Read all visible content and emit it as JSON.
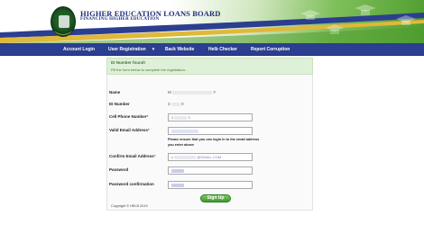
{
  "header": {
    "title": "HIGHER EDUCATION LOANS BOARD",
    "subtitle": "FINANCING HIGHER EDUCATION"
  },
  "nav": {
    "items": [
      {
        "label": "Account Login"
      },
      {
        "label": "User Registration"
      },
      {
        "label": "Back Website"
      },
      {
        "label": "Helb Checker"
      },
      {
        "label": "Report Corruption"
      }
    ]
  },
  "alert": {
    "title": "ID Number found!",
    "text": "Fill the form below to complete the registration..."
  },
  "form": {
    "name_label": "Name",
    "name_value_start": "M",
    "name_value_end": "Y",
    "id_label": "ID Number",
    "id_value_start": "3",
    "id_value_end": "0",
    "phone_label": "Cell Phone Number",
    "phone_value_start": "0",
    "phone_value_end": "5",
    "email_label": "Valid Email Address",
    "email_hint": "Please ensure that you can login in to the email address you enter above",
    "confirm_email_label": "Confirm Email Address",
    "confirm_email_value_start": "s",
    "confirm_email_value_end": "@GMAIL.COM",
    "password_label": "Password",
    "password_confirm_label": "Password confirmation",
    "required_mark": "*",
    "submit_label": "Sign Up"
  },
  "footer": {
    "copyright": "Copyright © HELB 2019"
  },
  "colors": {
    "nav_bg": "#2b3e8f",
    "brand_blue": "#1f2e7a",
    "brand_green": "#4f9d2f",
    "alert_bg": "#dff0d8",
    "button_green": "#3f9a2b"
  }
}
